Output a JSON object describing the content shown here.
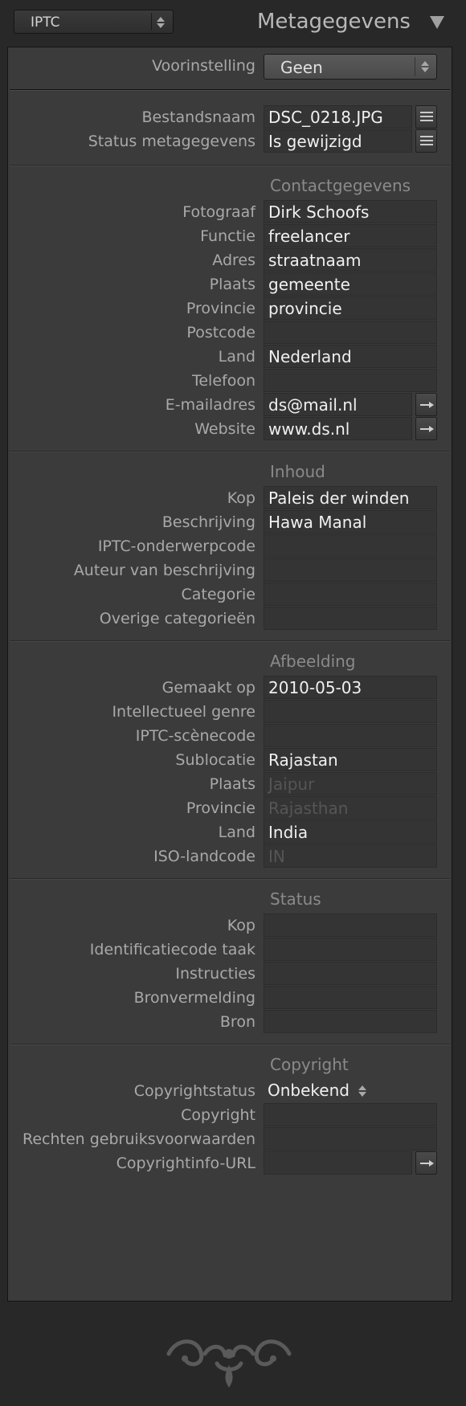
{
  "topbar": {
    "preset_dropdown": "IPTC",
    "panel_title": "Metagegevens"
  },
  "preset": {
    "label": "Voorinstelling",
    "value": "Geen"
  },
  "file": {
    "rows": [
      {
        "label": "Bestandsnaam",
        "value": "DSC_0218.JPG",
        "icon": "list-icon"
      },
      {
        "label": "Status metagegevens",
        "value": "Is gewijzigd",
        "icon": "list-icon"
      }
    ]
  },
  "contact": {
    "heading": "Contactgegevens",
    "rows": [
      {
        "label": "Fotograaf",
        "value": "Dirk Schoofs"
      },
      {
        "label": "Functie",
        "value": "freelancer"
      },
      {
        "label": "Adres",
        "value": "straatnaam"
      },
      {
        "label": "Plaats",
        "value": "gemeente"
      },
      {
        "label": "Provincie",
        "value": "provincie"
      },
      {
        "label": "Postcode",
        "value": ""
      },
      {
        "label": "Land",
        "value": "Nederland"
      },
      {
        "label": "Telefoon",
        "value": ""
      },
      {
        "label": "E-mailadres",
        "value": "ds@mail.nl",
        "icon": "arrow-right-icon"
      },
      {
        "label": "Website",
        "value": "www.ds.nl",
        "icon": "arrow-right-icon"
      }
    ]
  },
  "content": {
    "heading": "Inhoud",
    "rows": [
      {
        "label": "Kop",
        "value": "Paleis der winden"
      },
      {
        "label": "Beschrijving",
        "value": "Hawa Manal"
      },
      {
        "label": "IPTC-onderwerpcode",
        "value": ""
      },
      {
        "label": "Auteur van beschrijving",
        "value": ""
      },
      {
        "label": "Categorie",
        "value": ""
      },
      {
        "label": "Overige categorieën",
        "value": ""
      }
    ]
  },
  "image": {
    "heading": "Afbeelding",
    "rows": [
      {
        "label": "Gemaakt op",
        "value": "2010-05-03"
      },
      {
        "label": "Intellectueel genre",
        "value": ""
      },
      {
        "label": "IPTC-scènecode",
        "value": ""
      },
      {
        "label": "Sublocatie",
        "value": "Rajastan"
      },
      {
        "label": "Plaats",
        "value": "Jaipur",
        "dim": true
      },
      {
        "label": "Provincie",
        "value": "Rajasthan",
        "dim": true
      },
      {
        "label": "Land",
        "value": "India"
      },
      {
        "label": "ISO-landcode",
        "value": "IN",
        "dim": true
      }
    ]
  },
  "status": {
    "heading": "Status",
    "rows": [
      {
        "label": "Kop",
        "value": ""
      },
      {
        "label": "Identificatiecode taak",
        "value": ""
      },
      {
        "label": "Instructies",
        "value": ""
      },
      {
        "label": "Bronvermelding",
        "value": ""
      },
      {
        "label": "Bron",
        "value": ""
      }
    ]
  },
  "copyright": {
    "heading": "Copyright",
    "status_label": "Copyrightstatus",
    "status_value": "Onbekend",
    "rows": [
      {
        "label": "Copyright",
        "value": ""
      },
      {
        "label": "Rechten gebruiksvoorwaarden",
        "value": ""
      },
      {
        "label": "Copyrightinfo-URL",
        "value": "",
        "icon": "arrow-right-icon"
      }
    ]
  },
  "colors": {
    "panel_bg": "#3b3b3b",
    "field_bg": "#343434",
    "label_text": "#a9a9a9",
    "value_text": "#f0f0f0",
    "dim_value_text": "#555555"
  }
}
